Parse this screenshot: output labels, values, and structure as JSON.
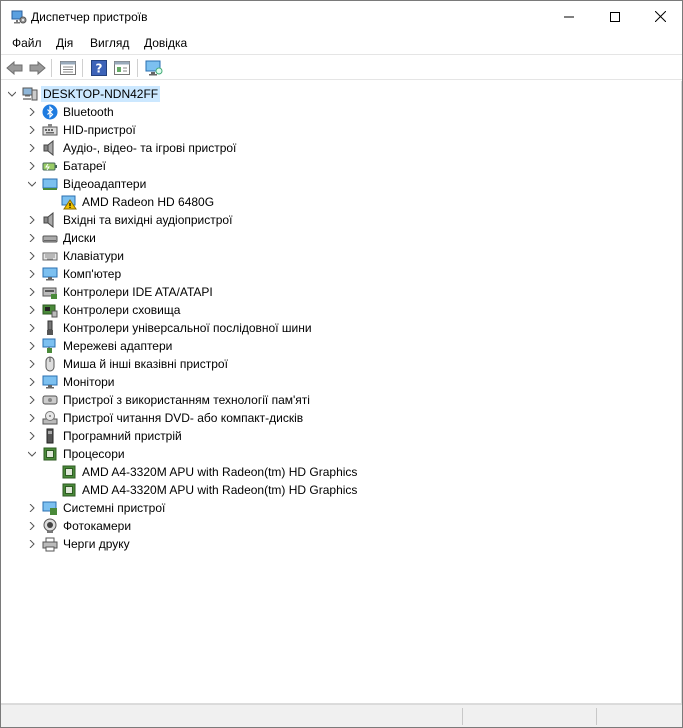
{
  "window": {
    "title": "Диспетчер пристроїв"
  },
  "menu": [
    "Файл",
    "Дія",
    "Вигляд",
    "Довідка"
  ],
  "toolbar": {
    "icons": [
      "back-icon",
      "forward-icon",
      "properties-icon",
      "help-icon",
      "update-driver-icon",
      "monitor-scan-icon"
    ]
  },
  "tree": {
    "root": "DESKTOP-NDN42FF",
    "items": [
      {
        "label": "Bluetooth",
        "icon": "bluetooth-icon",
        "expanded": false
      },
      {
        "label": "HID-пристрої",
        "icon": "hid-icon",
        "expanded": false
      },
      {
        "label": "Аудіо-, відео- та ігрові пристрої",
        "icon": "speaker-icon",
        "expanded": false
      },
      {
        "label": "Батареї",
        "icon": "battery-icon",
        "expanded": false
      },
      {
        "label": "Відеоадаптери",
        "icon": "display-adapter-icon",
        "expanded": true,
        "children": [
          {
            "label": "AMD Radeon HD 6480G",
            "icon": "warning-display-icon"
          }
        ]
      },
      {
        "label": "Вхідні та вихідні аудіопристрої",
        "icon": "speaker-icon",
        "expanded": false
      },
      {
        "label": "Диски",
        "icon": "disk-icon",
        "expanded": false
      },
      {
        "label": "Клавіатури",
        "icon": "keyboard-icon",
        "expanded": false
      },
      {
        "label": "Комп'ютер",
        "icon": "computer-icon",
        "expanded": false
      },
      {
        "label": "Контролери IDE ATA/ATAPI",
        "icon": "ide-icon",
        "expanded": false
      },
      {
        "label": "Контролери сховища",
        "icon": "storage-icon",
        "expanded": false
      },
      {
        "label": "Контролери універсальної послідовної шини",
        "icon": "usb-icon",
        "expanded": false
      },
      {
        "label": "Мережеві адаптери",
        "icon": "network-icon",
        "expanded": false
      },
      {
        "label": "Миша й інші вказівні пристрої",
        "icon": "mouse-icon",
        "expanded": false
      },
      {
        "label": "Монітори",
        "icon": "monitor-icon",
        "expanded": false
      },
      {
        "label": "Пристрої з використанням технології пам'яті",
        "icon": "memory-icon",
        "expanded": false
      },
      {
        "label": "Пристрої читання DVD- або компакт-дисків",
        "icon": "dvd-icon",
        "expanded": false
      },
      {
        "label": "Програмний пристрій",
        "icon": "software-device-icon",
        "expanded": false
      },
      {
        "label": "Процесори",
        "icon": "processor-icon",
        "expanded": true,
        "children": [
          {
            "label": "AMD A4-3320M APU with Radeon(tm) HD Graphics",
            "icon": "processor-icon"
          },
          {
            "label": "AMD A4-3320M APU with Radeon(tm) HD Graphics",
            "icon": "processor-icon"
          }
        ]
      },
      {
        "label": "Системні пристрої",
        "icon": "system-device-icon",
        "expanded": false
      },
      {
        "label": "Фотокамери",
        "icon": "camera-icon",
        "expanded": false
      },
      {
        "label": "Черги друку",
        "icon": "printer-icon",
        "expanded": false
      }
    ]
  },
  "colors": {
    "selection": "#cce8ff",
    "warning": "#f2c200",
    "accent": "#2a7fd4"
  }
}
